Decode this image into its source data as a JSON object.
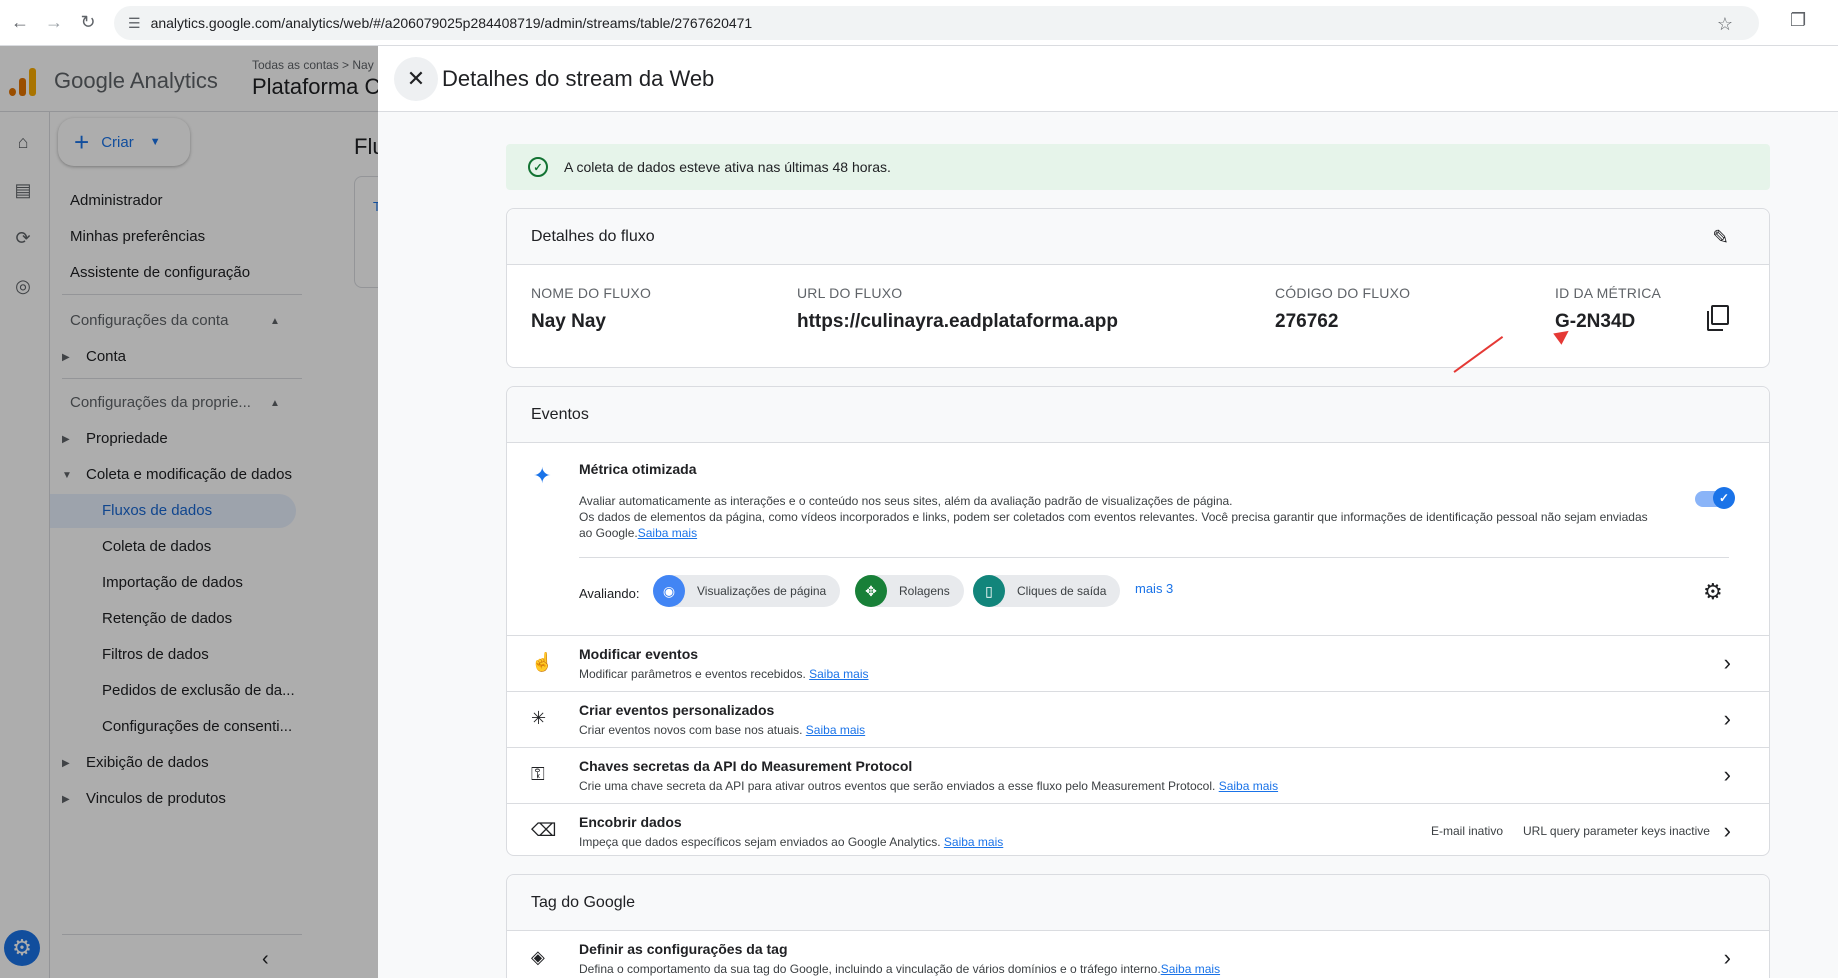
{
  "browser": {
    "url": "analytics.google.com/analytics/web/#/a206079025p284408719/admin/streams/table/2767620471"
  },
  "ga": {
    "brand": "Google Analytics",
    "breadcrumb": "Todas as contas  >  Nay",
    "property": "Plataforma C",
    "logo_colors": [
      "#f9ab00",
      "#e37400",
      "#e37400"
    ]
  },
  "sidenav": {
    "create": "Criar",
    "items": {
      "admin": "Administrador",
      "prefs": "Minhas preferências",
      "setup": "Assistente de configuração",
      "account_section": "Configurações da conta",
      "account": "Conta",
      "property_section": "Configurações da proprie...",
      "property": "Propriedade",
      "collection": "Coleta e modificação de dados",
      "streams": "Fluxos de dados",
      "data_collection": "Coleta de dados",
      "import": "Importação de dados",
      "retention": "Retenção de dados",
      "filters": "Filtros de dados",
      "deletion": "Pedidos de exclusão de da...",
      "consent": "Configurações de consenti...",
      "display": "Exibição de dados",
      "links": "Vinculos de produtos"
    }
  },
  "behind": {
    "title": "Flu",
    "card_letter": "T"
  },
  "drawer": {
    "title": "Detalhes do stream da Web",
    "alert": "A coleta de dados esteve ativa nas últimas 48 horas.",
    "details": {
      "header": "Detalhes do fluxo",
      "name_label": "NOME DO FLUXO",
      "name_value": "Nay Nay",
      "url_label": "URL DO FLUXO",
      "url_value": "https://culinayra.eadplataforma.app",
      "code_label": "CÓDIGO DO FLUXO",
      "code_value": "276762",
      "metric_label": "ID DA MÉTRICA",
      "metric_value": "G-2N34D"
    },
    "events": {
      "header": "Eventos",
      "enhanced_title": "Métrica otimizada",
      "enhanced_desc1": "Avaliar automaticamente as interações e o conteúdo nos seus sites, além da avaliação padrão de visualizações de página.",
      "enhanced_desc2": "Os dados de elementos da página, como vídeos incorporados e links, podem ser coletados com eventos relevantes. Você precisa garantir que informações de identificação pessoal não sejam enviadas ao Google.",
      "learn_more": "Saiba mais",
      "evaluating": "Avaliando:",
      "chips": [
        {
          "label": "Visualizações de página",
          "color": "#4285f4"
        },
        {
          "label": "Rolagens",
          "color": "#188038"
        },
        {
          "label": "Cliques de saída",
          "color": "#12857b"
        }
      ],
      "more": "mais 3",
      "rows": [
        {
          "title": "Modificar eventos",
          "desc": "Modificar parâmetros e eventos recebidos."
        },
        {
          "title": "Criar eventos personalizados",
          "desc": "Criar eventos novos com base nos atuais."
        },
        {
          "title": "Chaves secretas da API do Measurement Protocol",
          "desc": "Crie uma chave secreta da API para ativar outros eventos que serão enviados a esse fluxo pelo Measurement Protocol."
        },
        {
          "title": "Encobrir dados",
          "desc": "Impeça que dados específicos sejam enviados ao Google Analytics.",
          "badge1": "E-mail inativo",
          "badge2": "URL query parameter keys inactive"
        }
      ]
    },
    "tag": {
      "header": "Tag do Google",
      "row_title": "Definir as configurações da tag",
      "row_desc": "Defina o comportamento da sua tag do Google, incluindo a vinculação de vários domínios e o tráfego interno."
    }
  }
}
